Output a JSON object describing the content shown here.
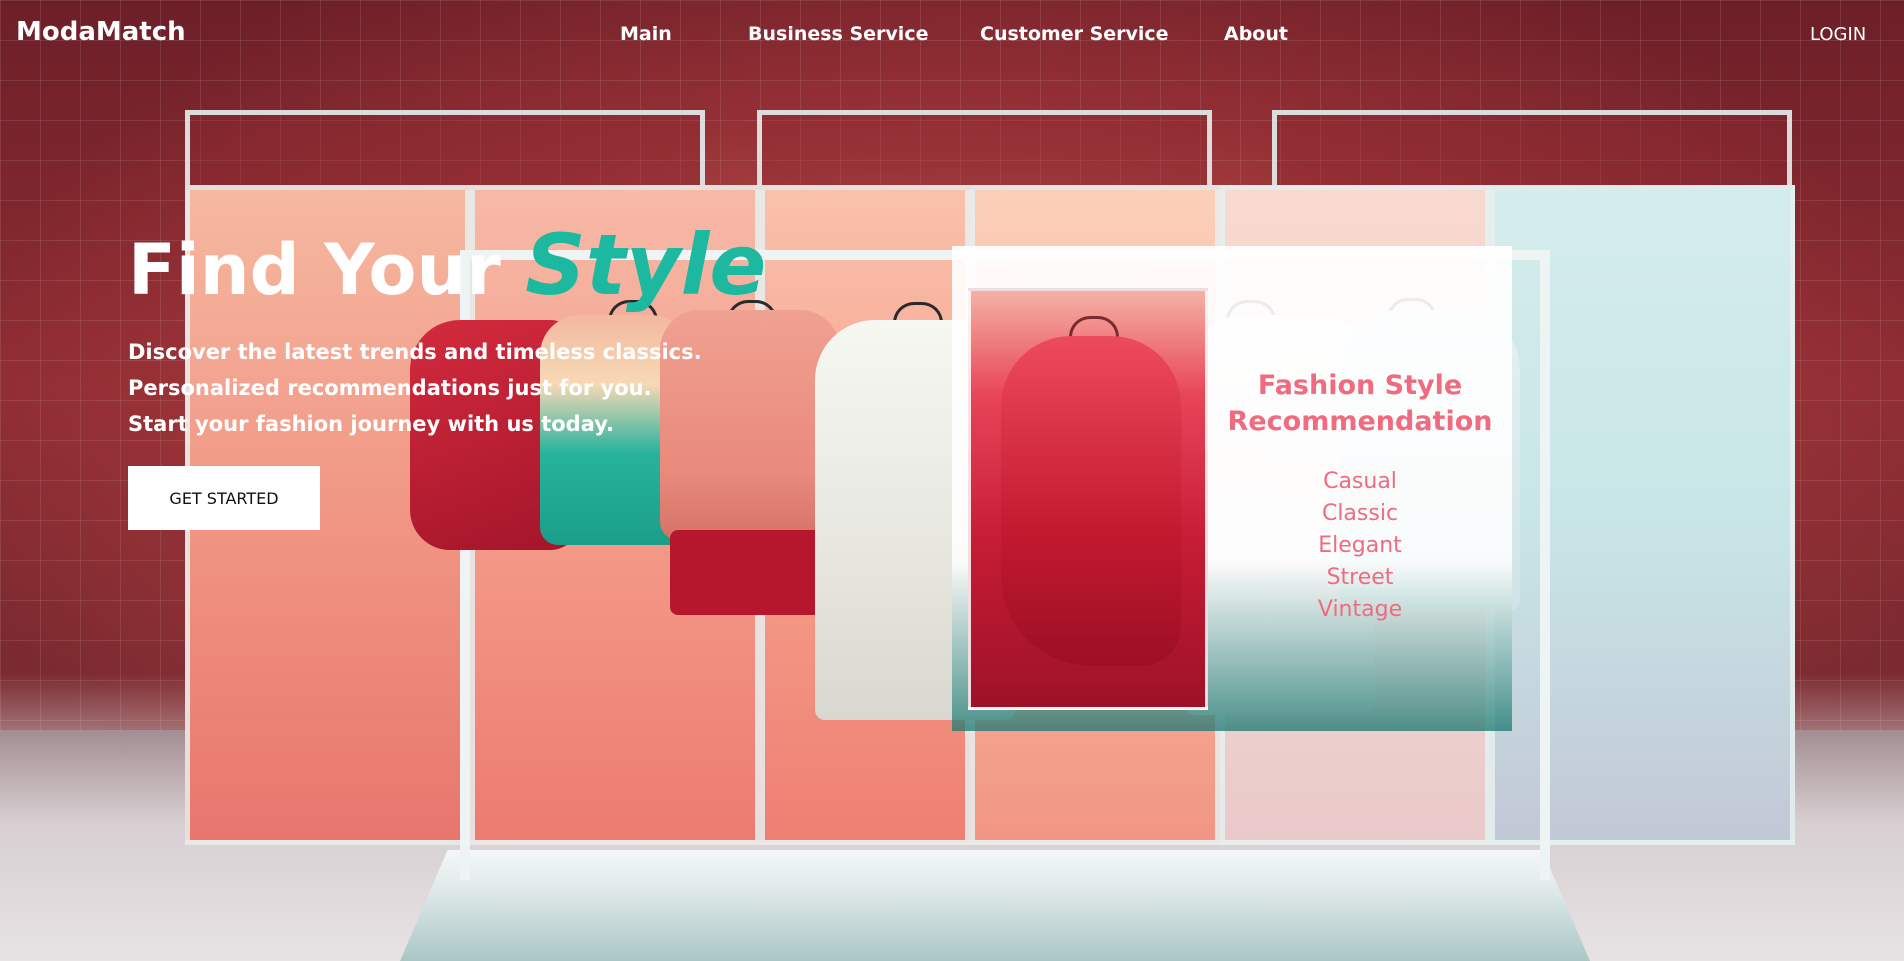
{
  "nav": {
    "brand": "ModaMatch",
    "links": [
      {
        "label": "Main"
      },
      {
        "label": "Business Service"
      },
      {
        "label": "Customer Service"
      },
      {
        "label": "About"
      }
    ],
    "login": "LOGIN"
  },
  "hero": {
    "title_prefix": "Find Your",
    "title_accent": "Style",
    "lines": [
      "Discover the latest trends and timeless classics.",
      "Personalized recommendations just for you.",
      "Start your fashion journey with us today."
    ],
    "cta": "GET STARTED"
  },
  "recommendation": {
    "title_line1": "Fashion Style",
    "title_line2": "Recommendation",
    "styles": [
      "Casual",
      "Classic",
      "Elegant",
      "Street",
      "Vintage"
    ]
  },
  "colors": {
    "accent_teal": "#1cb8a0",
    "recommendation_pink": "#ef6b7f"
  }
}
